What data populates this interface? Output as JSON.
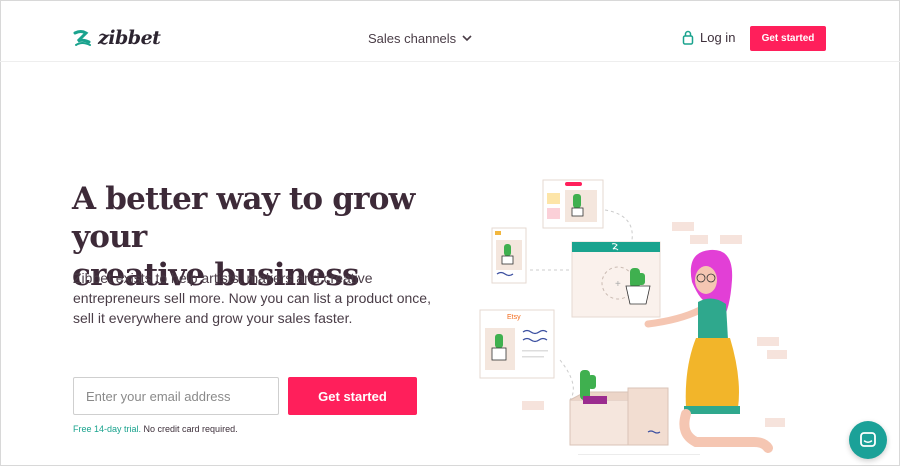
{
  "header": {
    "logo_text": "zibbet",
    "nav_sales_channels": "Sales channels",
    "login_label": "Log in",
    "cta_label": "Get started"
  },
  "hero": {
    "headline_line1": "A better way to grow your",
    "headline_line2": "creative business",
    "description": "Zibbet exists to help artists, makers and creative entrepreneurs sell more. Now you can list a product once, sell it everywhere and grow your sales faster.",
    "email_placeholder": "Enter your email address",
    "cta_label": "Get started",
    "trial_highlight": "Free 14-day trial.",
    "trial_rest": " No credit card required."
  },
  "illustration": {
    "etsy_label": "Etsy"
  },
  "colors": {
    "brand_pink": "#ff1f5b",
    "brand_teal": "#1aa38e",
    "heading": "#3d2a38"
  },
  "icons": {
    "logo": "zibbet-logo-icon",
    "dropdown": "chevron-down-icon",
    "login": "lock-icon",
    "chat": "chat-icon"
  }
}
